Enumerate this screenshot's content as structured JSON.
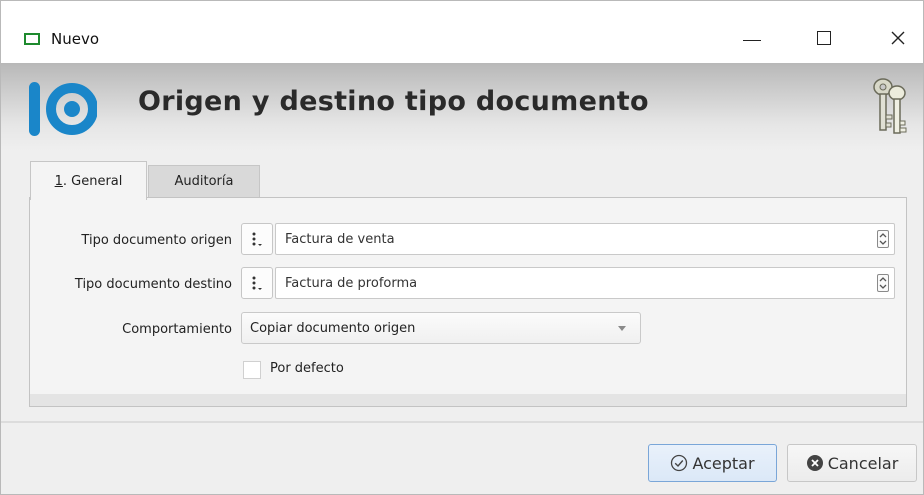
{
  "window": {
    "title": "Nuevo",
    "controls": [
      "minimize-icon",
      "maximize-icon",
      "close-icon"
    ]
  },
  "banner": {
    "title": "Origen y destino tipo documento",
    "logo_icon": "app-logo",
    "right_icon": "keys-icon",
    "logo_color": "#1a86c9"
  },
  "tabs": [
    {
      "label": "1. General",
      "active": true
    },
    {
      "label": "Auditoría",
      "active": false
    }
  ],
  "form": {
    "origen": {
      "label": "Tipo documento origen",
      "value": "Factura de venta"
    },
    "destino": {
      "label": "Tipo documento destino",
      "value": "Factura de proforma"
    },
    "comportamiento": {
      "label": "Comportamiento",
      "value": "Copiar documento origen"
    },
    "por_defecto": {
      "label": "Por defecto",
      "checked": false
    }
  },
  "buttons": {
    "accept": "Aceptar",
    "cancel": "Cancelar"
  }
}
